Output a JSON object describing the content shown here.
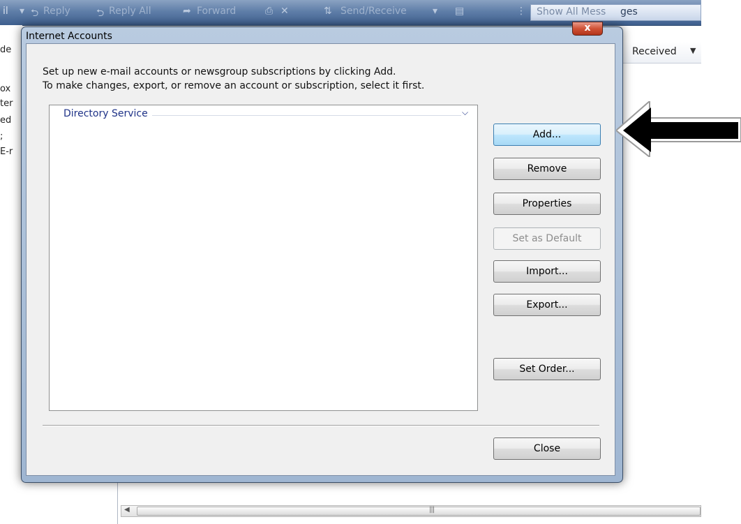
{
  "toolbar": {
    "items": [
      "il",
      "Reply",
      "Reply All",
      "Forward",
      "Send/Receive"
    ],
    "search_text_a": "Show All Mess",
    "search_text_b": "ges"
  },
  "folder_pane": {
    "fragments": [
      "de",
      "ox",
      "ter",
      "ed",
      ";",
      "E-r"
    ]
  },
  "message_list": {
    "column_header": "Received"
  },
  "dialog": {
    "title": "Internet Accounts",
    "close_glyph": "x",
    "instructions": [
      "Set up new e-mail accounts or newsgroup subscriptions by clicking Add.",
      "To make changes, export, or remove an account or subscription, select it first."
    ],
    "group_label": "Directory Service",
    "buttons": {
      "add": "Add...",
      "remove": "Remove",
      "properties": "Properties",
      "set_default": "Set as Default",
      "import": "Import...",
      "export": "Export...",
      "set_order": "Set Order...",
      "close": "Close"
    }
  },
  "colors": {
    "titlebar": "#9fb6d2",
    "group_text": "#1e3287",
    "close_button": "#d05236",
    "annotation_arrow": "#000000"
  }
}
